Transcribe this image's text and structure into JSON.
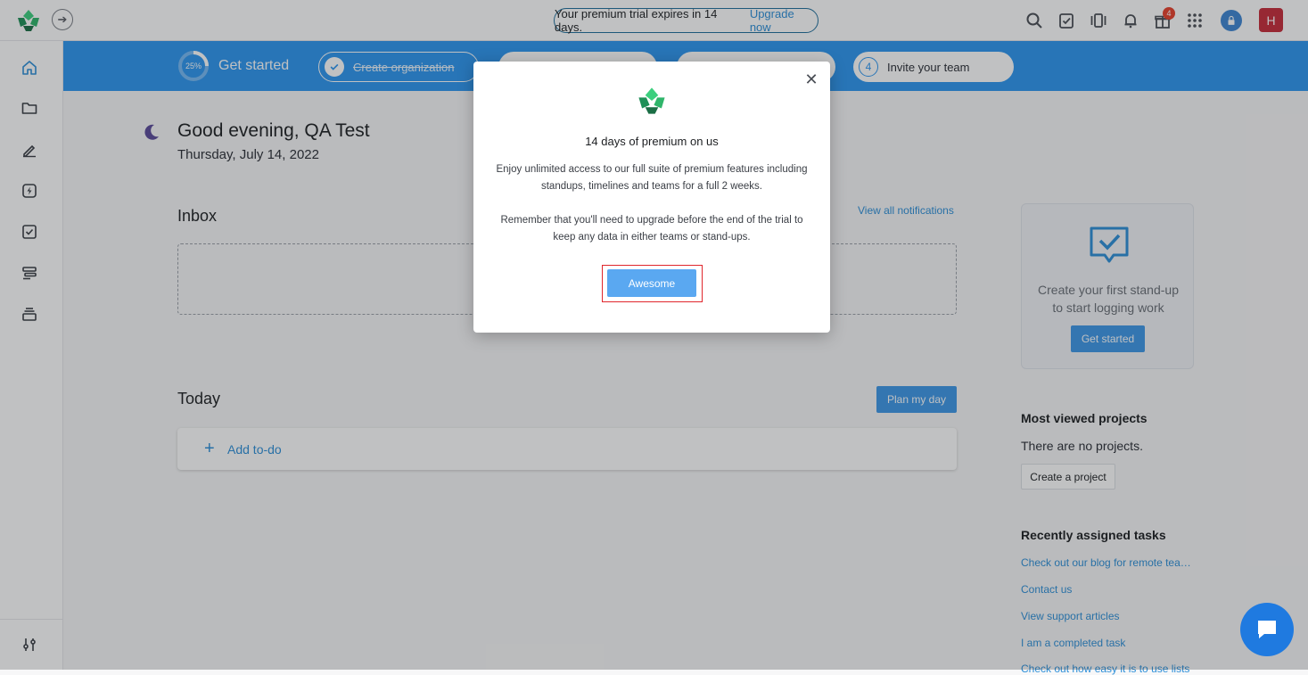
{
  "topbar": {
    "trial_text": "Your premium trial expires in 14 days.",
    "upgrade_link": "Upgrade now",
    "notification_count": "4",
    "avatar_initial": "H",
    "icons": [
      "search-icon",
      "task-check-icon",
      "timeline-icon",
      "bell-icon",
      "gift-icon",
      "apps-grid-icon",
      "lock-user-icon"
    ]
  },
  "sidebar": {
    "items": [
      "home-icon",
      "folder-icon",
      "edit-pen-icon",
      "lightning-icon",
      "checklist-icon",
      "stack-icon",
      "inbox-tray-icon"
    ],
    "bottom": "sliders-icon"
  },
  "steps": {
    "progress": "25%",
    "progress_fraction": 0.25,
    "title": "Get started",
    "items": [
      {
        "label": "Create organization",
        "done": true
      },
      {
        "label": "",
        "done": false
      },
      {
        "label": "",
        "done": false
      },
      {
        "number": "4",
        "label": "Invite your team",
        "done": false
      }
    ]
  },
  "main": {
    "greeting": "Good evening, QA Test",
    "date": "Thursday, July 14, 2022",
    "inbox_title": "Inbox",
    "view_all": "View all notifications",
    "today_title": "Today",
    "plan_button": "Plan my day",
    "add_todo": "Add to-do"
  },
  "right": {
    "standup_text": "Create your first stand-up to start logging work",
    "standup_button": "Get started",
    "most_viewed_title": "Most viewed projects",
    "most_viewed_empty": "There are no projects.",
    "create_project": "Create a project",
    "recent_tasks_title": "Recently assigned tasks",
    "recent_tasks": [
      "Check out our blog for remote tea…",
      "Contact us",
      "View support articles",
      "I am a completed task",
      "Check out how easy it is to use lists"
    ]
  },
  "modal": {
    "title": "14 days of premium on us",
    "paragraph1": "Enjoy unlimited access to our full suite of premium features including standups, timelines and teams for a full 2 weeks.",
    "paragraph2": "Remember that you'll need to upgrade before the end of the trial to keep any data in either teams or stand-ups.",
    "button": "Awesome"
  },
  "colors": {
    "brand_blue": "#2d96f0",
    "link": "#2d8fd8",
    "highlight_red": "#e0262c",
    "badge_red": "#e8412c",
    "avatar_red": "#c62c3a"
  }
}
